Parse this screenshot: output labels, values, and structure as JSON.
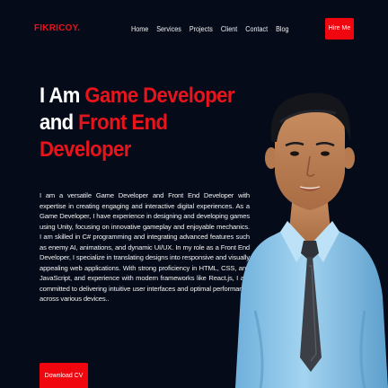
{
  "header": {
    "logo": "FIKRICOY.",
    "nav": [
      "Home",
      "Services",
      "Projects",
      "Client",
      "Contact",
      "Blog"
    ],
    "hire_label": "Hire Me"
  },
  "hero": {
    "title": {
      "prefix": "I Am ",
      "accent1": "Game Developer",
      "joiner": "and ",
      "accent2_line1": "Front End",
      "accent2_line2": "Developer"
    },
    "bio": "I am a versatile Game Developer and Front End Developer with expertise in creating engaging and interactive digital experiences. As a Game Developer, I have experience in designing and developing games using Unity, focusing on innovative gameplay and enjoyable mechanics. I am skilled in C# programming and integrating advanced features such as enemy AI, animations, and dynamic UI/UX. In my role as a Front End Developer, I specialize in translating designs into responsive and visually appealing web applications. With strong proficiency in HTML, CSS, and JavaScript, and experience with modern frameworks like React.js, I am committed to delivering intuitive user interfaces and optimal performance across various devices..",
    "download_label": "Download CV"
  },
  "colors": {
    "background": "#050b19",
    "accent": "#e8141b",
    "button": "#f0060e",
    "shirt": "#8ec3e6",
    "tie": "#3c3f46"
  },
  "icons": {
    "portrait": "developer-portrait-photo"
  }
}
